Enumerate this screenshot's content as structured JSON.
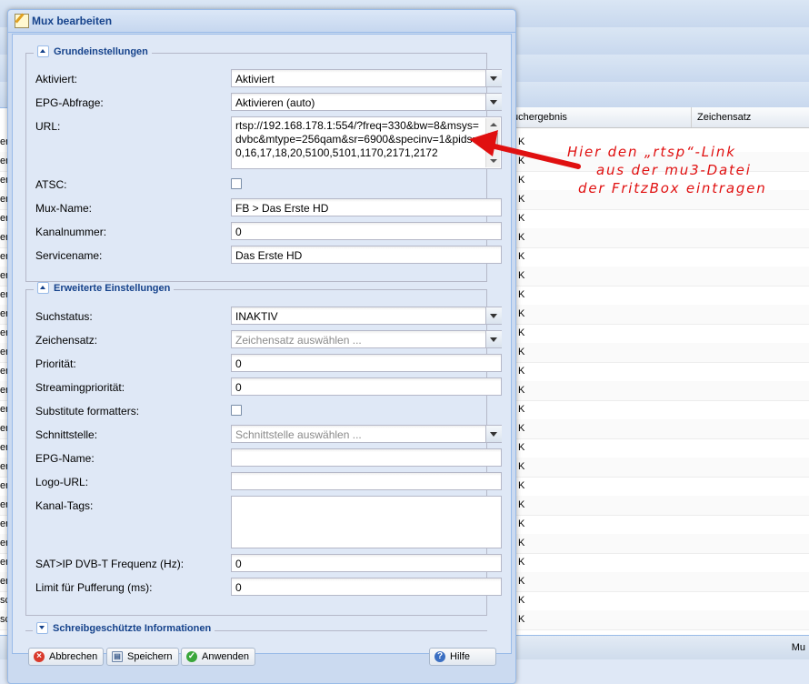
{
  "background": {
    "column_headers": [
      "uchergebnis",
      "Zeichensatz"
    ],
    "row_left_text": [
      "er",
      "er",
      "er",
      "er",
      "er",
      "er",
      "er",
      "er",
      "er",
      "er",
      "er",
      "er",
      "er",
      "er",
      "er",
      "er",
      "er",
      "er",
      "er",
      "er",
      "er",
      "er",
      "er",
      "er",
      "sc",
      "sc"
    ],
    "row_value": "K",
    "footer_text": "Mu"
  },
  "window": {
    "title": "Mux bearbeiten",
    "sections": {
      "basic": {
        "legend": "Grundeinstellungen"
      },
      "advanced": {
        "legend": "Erweiterte Einstellungen"
      },
      "readonly": {
        "legend": "Schreibgeschützte Informationen"
      }
    },
    "fields": {
      "enabled": {
        "label": "Aktiviert:",
        "value": "Aktiviert"
      },
      "epg_scan": {
        "label": "EPG-Abfrage:",
        "value": "Aktivieren (auto)"
      },
      "url": {
        "label": "URL:",
        "value": "rtsp://192.168.178.1:554/?freq=330&bw=8&msys=dvbc&mtype=256qam&sr=6900&specinv=1&pids=0,16,17,18,20,5100,5101,1170,2171,2172"
      },
      "atsc": {
        "label": "ATSC:"
      },
      "mux_name": {
        "label": "Mux-Name:",
        "value": "FB > Das Erste HD"
      },
      "channel_number": {
        "label": "Kanalnummer:",
        "value": "0"
      },
      "service_name": {
        "label": "Servicename:",
        "value": "Das Erste HD"
      },
      "scan_status": {
        "label": "Suchstatus:",
        "value": "INAKTIV"
      },
      "charset": {
        "label": "Zeichensatz:",
        "placeholder": "Zeichensatz auswählen ..."
      },
      "priority": {
        "label": "Priorität:",
        "value": "0"
      },
      "streaming_priority": {
        "label": "Streamingpriorität:",
        "value": "0"
      },
      "substitute_formatters": {
        "label": "Substitute formatters:"
      },
      "interface": {
        "label": "Schnittstelle:",
        "placeholder": "Schnittstelle auswählen ..."
      },
      "epg_name": {
        "label": "EPG-Name:",
        "value": ""
      },
      "logo_url": {
        "label": "Logo-URL:",
        "value": ""
      },
      "channel_tags": {
        "label": "Kanal-Tags:",
        "value": ""
      },
      "satip_freq": {
        "label": "SAT>IP DVB-T Frequenz (Hz):",
        "value": "0"
      },
      "buffer_limit": {
        "label": "Limit für Pufferung (ms):",
        "value": "0"
      }
    },
    "buttons": {
      "cancel": "Abbrechen",
      "save": "Speichern",
      "apply": "Anwenden",
      "help": "Hilfe"
    }
  },
  "annotation": {
    "line1": "Hier den „rtsp“-Link",
    "line2": "aus der mu3-Datei",
    "line3": "der FritzBox eintragen",
    "color": "#e01010"
  }
}
